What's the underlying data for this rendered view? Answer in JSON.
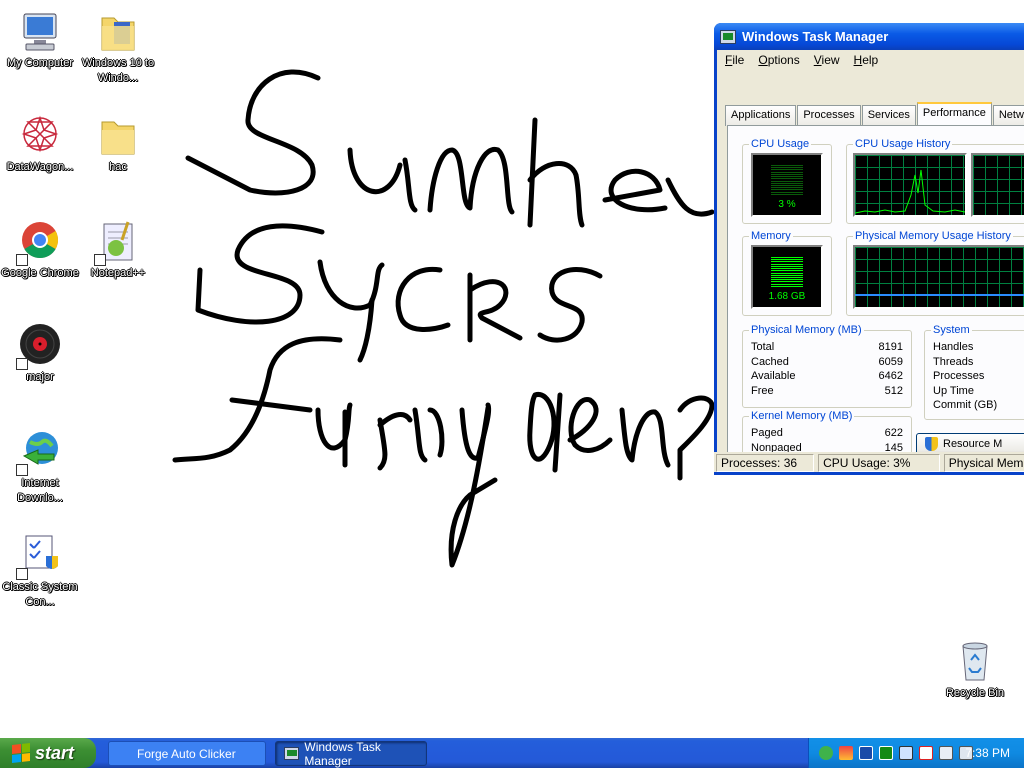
{
  "desktop": {
    "icons": [
      {
        "label": "My Computer"
      },
      {
        "label": "Windows 10 to Windo..."
      },
      {
        "label": "DataWagon..."
      },
      {
        "label": "hac"
      },
      {
        "label": "Google Chrome"
      },
      {
        "label": "Notepad++"
      },
      {
        "label": "major"
      },
      {
        "label": "Internet Downlo..."
      },
      {
        "label": "Classic System Con..."
      },
      {
        "label": "Recycle Bin"
      }
    ]
  },
  "task_manager": {
    "title": "Windows Task Manager",
    "menu": [
      "File",
      "Options",
      "View",
      "Help"
    ],
    "tabs": [
      "Applications",
      "Processes",
      "Services",
      "Performance",
      "Networking"
    ],
    "active_tab": "Performance",
    "cpu_usage": {
      "title": "CPU Usage",
      "value": "3 %",
      "percent": 3
    },
    "cpu_history": {
      "title": "CPU Usage History"
    },
    "memory": {
      "title": "Memory",
      "value": "1.68 GB"
    },
    "memory_history": {
      "title": "Physical Memory Usage History"
    },
    "physical_memory": {
      "title": "Physical Memory (MB)",
      "rows": [
        {
          "label": "Total",
          "value": "8191"
        },
        {
          "label": "Cached",
          "value": "6059"
        },
        {
          "label": "Available",
          "value": "6462"
        },
        {
          "label": "Free",
          "value": "512"
        }
      ]
    },
    "kernel_memory": {
      "title": "Kernel Memory (MB)",
      "rows": [
        {
          "label": "Paged",
          "value": "622"
        },
        {
          "label": "Nonpaged",
          "value": "145"
        }
      ]
    },
    "system": {
      "title": "System",
      "rows": [
        {
          "label": "Handles"
        },
        {
          "label": "Threads"
        },
        {
          "label": "Processes"
        },
        {
          "label": "Up Time"
        },
        {
          "label": "Commit (GB)"
        }
      ]
    },
    "resource_monitor_button": "Resource M",
    "status": {
      "processes": "Processes: 36",
      "cpu": "CPU Usage: 3%",
      "memory": "Physical Mem"
    }
  },
  "taskbar": {
    "start_label": "start",
    "buttons": [
      {
        "label": "Forge Auto Clicker"
      },
      {
        "label": "Windows Task Manager"
      }
    ],
    "clock": "7:38 PM"
  },
  "colors": {
    "accent_blue": "#0046d5",
    "graph_green": "#00ff00",
    "taskbar_blue": "#245edb",
    "start_green": "#3c8f33"
  }
}
